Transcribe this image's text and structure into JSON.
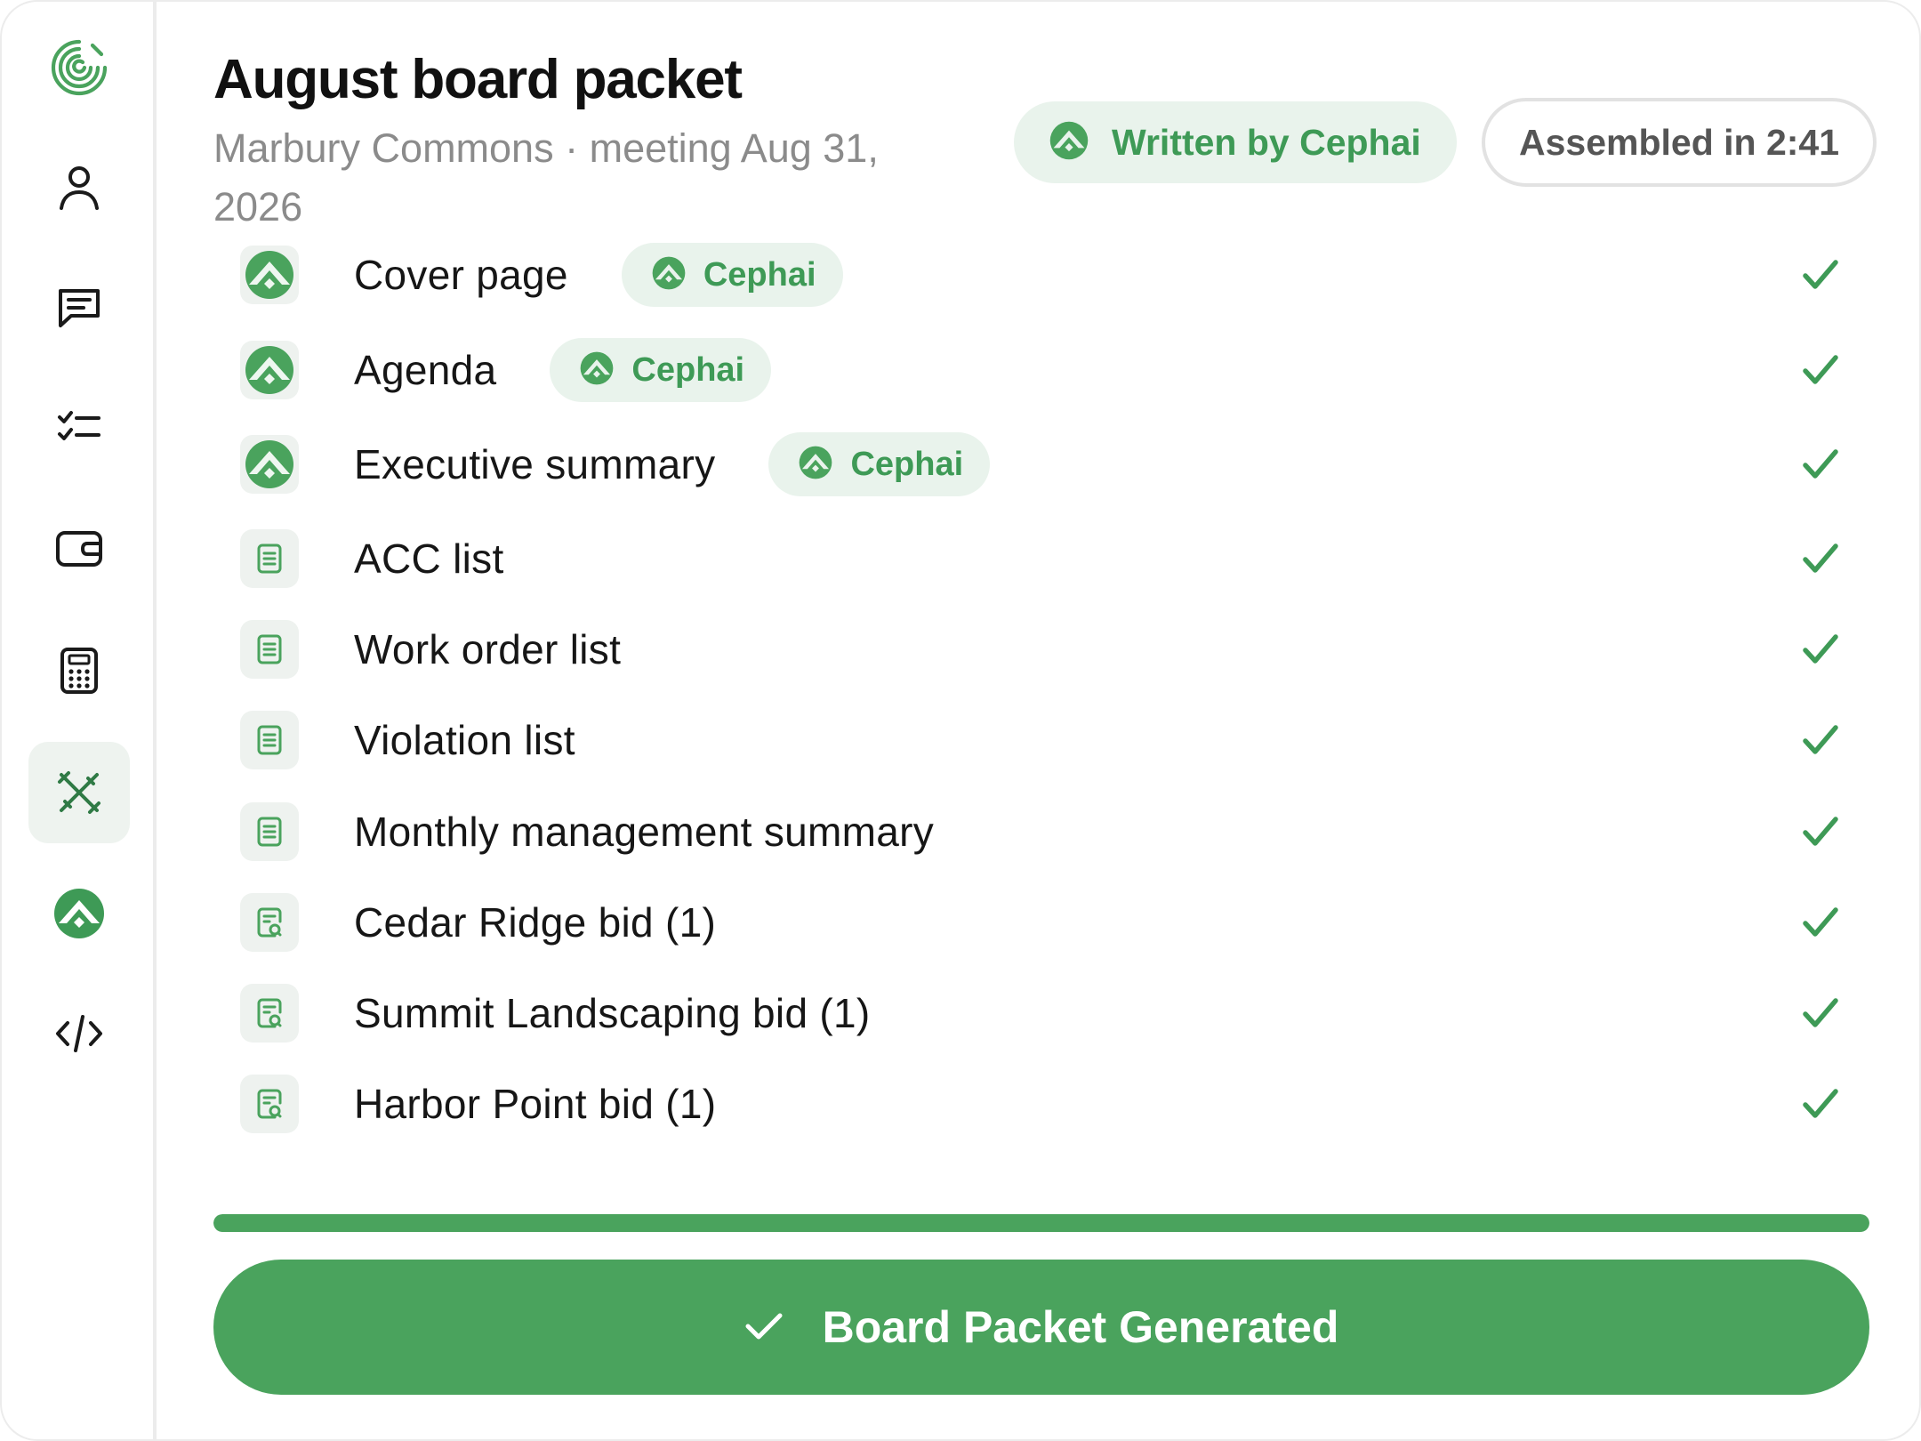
{
  "sidebar": {
    "items": [
      {
        "icon": "logo-spiral-icon",
        "active": false
      },
      {
        "icon": "user-icon",
        "active": false
      },
      {
        "icon": "chat-icon",
        "active": false
      },
      {
        "icon": "checklist-icon",
        "active": false
      },
      {
        "icon": "wallet-icon",
        "active": false
      },
      {
        "icon": "calculator-icon",
        "active": false
      },
      {
        "icon": "tools-icon",
        "active": true
      },
      {
        "icon": "cephai-icon",
        "active": false
      },
      {
        "icon": "code-icon",
        "active": false
      }
    ]
  },
  "header": {
    "title": "August board packet",
    "subtitle": "Marbury Commons · meeting Aug 31, 2026",
    "written_badge": "Written by Cephai",
    "assembled_badge": "Assembled in 2:41"
  },
  "items": [
    {
      "label": "Cover page",
      "tag": "Cephai",
      "icon": "cephai-icon",
      "done": true
    },
    {
      "label": "Agenda",
      "tag": "Cephai",
      "icon": "cephai-icon",
      "done": true
    },
    {
      "label": "Executive summary",
      "tag": "Cephai",
      "icon": "cephai-icon",
      "done": true
    },
    {
      "label": "ACC list",
      "tag": "",
      "icon": "document-icon",
      "done": true
    },
    {
      "label": "Work order list",
      "tag": "",
      "icon": "document-icon",
      "done": true
    },
    {
      "label": "Violation list",
      "tag": "",
      "icon": "document-icon",
      "done": true
    },
    {
      "label": "Monthly management summary",
      "tag": "",
      "icon": "document-icon",
      "done": true
    },
    {
      "label": "Cedar Ridge bid (1)",
      "tag": "",
      "icon": "bid-document-icon",
      "done": true
    },
    {
      "label": "Summit Landscaping bid (1)",
      "tag": "",
      "icon": "bid-document-icon",
      "done": true
    },
    {
      "label": "Harbor Point bid (1)",
      "tag": "",
      "icon": "bid-document-icon",
      "done": true
    }
  ],
  "progress": {
    "fraction": 1.0
  },
  "action": {
    "label": "Board Packet Generated"
  },
  "colors": {
    "accent": "#4aa35d",
    "accent_text": "#3e9a56",
    "pill_bg": "#e9f3ec",
    "muted_text": "#8b8b8b",
    "sidebar_active_bg": "#eef3ef"
  }
}
